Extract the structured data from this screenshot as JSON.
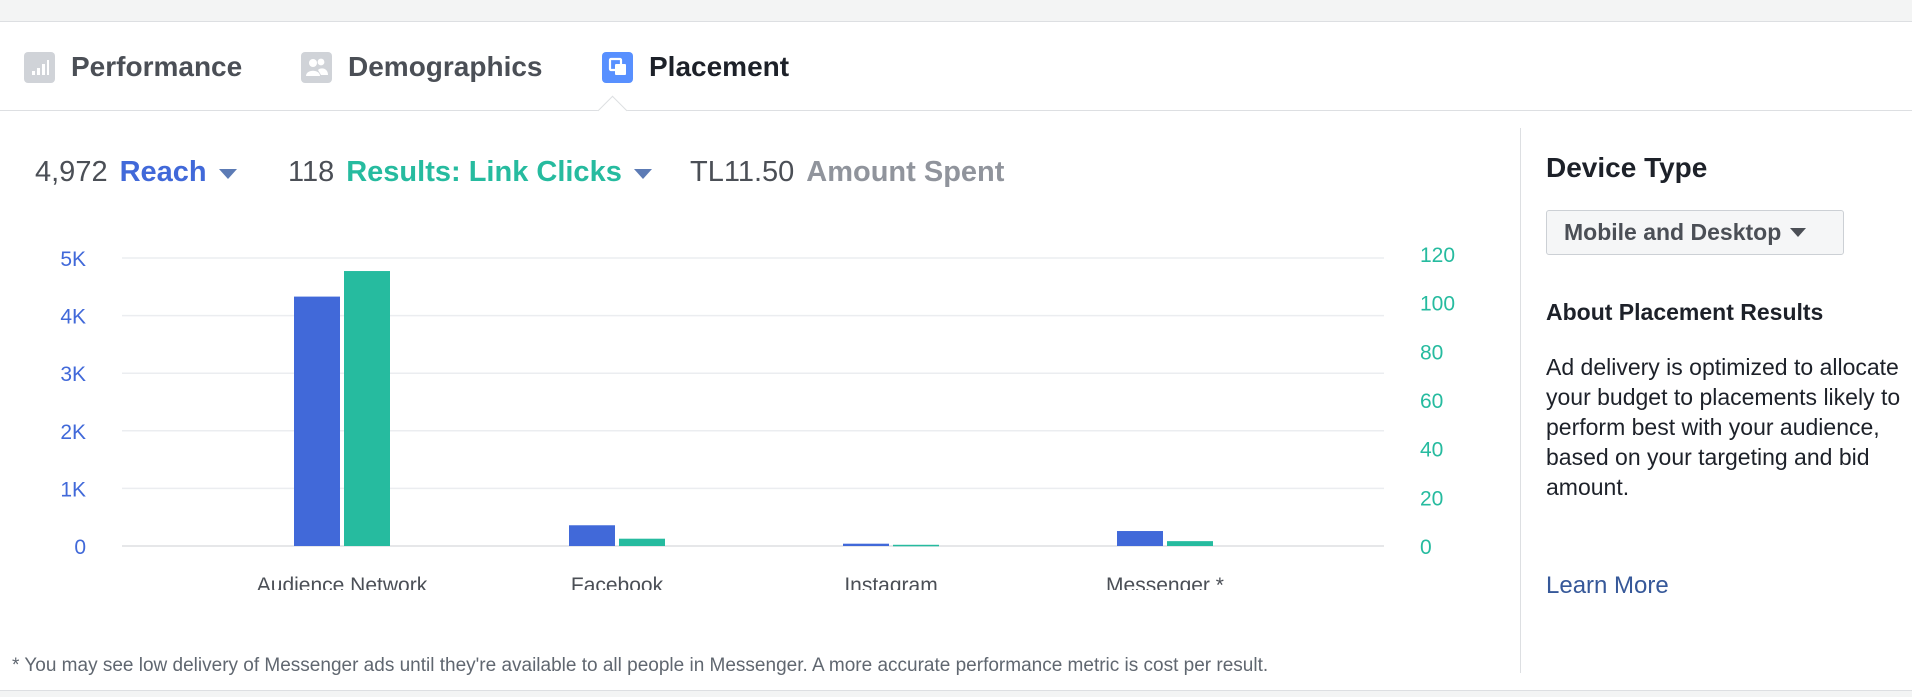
{
  "tabs": [
    {
      "label": "Performance",
      "icon": "bar-chart-icon",
      "active": false
    },
    {
      "label": "Demographics",
      "icon": "people-icon",
      "active": false
    },
    {
      "label": "Placement",
      "icon": "placement-icon",
      "active": true
    }
  ],
  "metrics": {
    "reach": {
      "value": "4,972",
      "label": "Reach"
    },
    "results": {
      "value": "118",
      "label": "Results: Link Clicks"
    },
    "spent": {
      "value": "TL11.50",
      "label": "Amount Spent"
    }
  },
  "colors": {
    "reach": "#4169d9",
    "results": "#26bb9f",
    "spent_label": "#90949c",
    "accent_tab": "#5890ff",
    "link": "#365899"
  },
  "chart_data": {
    "type": "bar",
    "categories": [
      "Audience Network",
      "Facebook",
      "Instagram",
      "Messenger *"
    ],
    "series": [
      {
        "name": "Reach",
        "axis": "left",
        "values": [
          4330,
          360,
          40,
          260
        ]
      },
      {
        "name": "Results: Link Clicks",
        "axis": "right",
        "values": [
          113,
          3,
          0.5,
          2
        ]
      }
    ],
    "left_axis": {
      "ticks": [
        "0",
        "1K",
        "2K",
        "3K",
        "4K",
        "5K"
      ],
      "tick_values": [
        0,
        1000,
        2000,
        3000,
        4000,
        5000
      ],
      "ylim": [
        0,
        5000
      ]
    },
    "right_axis": {
      "ticks": [
        "0",
        "20",
        "40",
        "60",
        "80",
        "100",
        "120"
      ],
      "tick_values": [
        0,
        20,
        40,
        60,
        80,
        100,
        120
      ],
      "ylim": [
        0,
        120
      ]
    },
    "grid": true
  },
  "footnote": "* You may see low delivery of Messenger ads until they're available to all people in Messenger. A more accurate performance metric is cost per result.",
  "sidebar": {
    "device_type_title": "Device Type",
    "device_type_value": "Mobile and Desktop",
    "about_title": "About Placement Results",
    "about_text": "Ad delivery is optimized to allocate your budget to placements likely to perform best with your audience, based on your targeting and bid amount.",
    "learn_more": "Learn More"
  }
}
